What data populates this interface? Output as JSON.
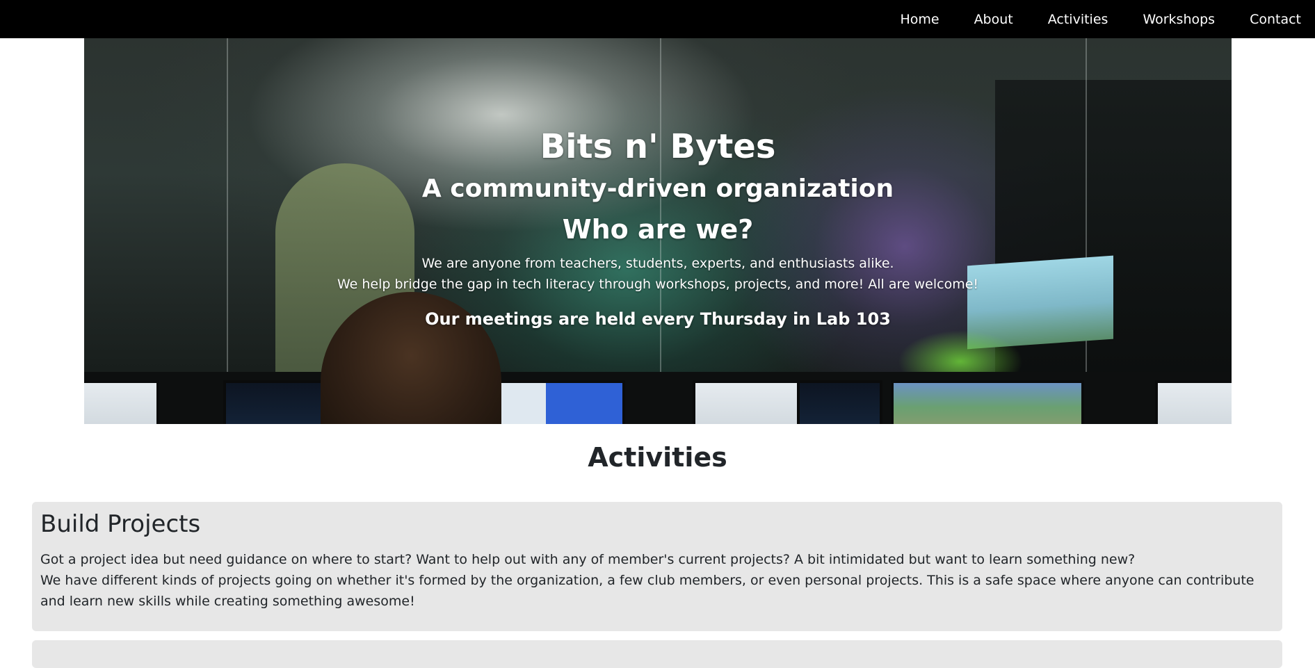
{
  "nav": {
    "items": [
      {
        "label": "Home"
      },
      {
        "label": "About"
      },
      {
        "label": "Activities"
      },
      {
        "label": "Workshops"
      },
      {
        "label": "Contact"
      }
    ]
  },
  "hero": {
    "title": "Bits n' Bytes",
    "subtitle": "A community-driven organization",
    "question": "Who are we?",
    "line1": "We are anyone from teachers, students, experts, and enthusiasts alike.",
    "line2": "We help bridge the gap in tech literacy through workshops, projects, and more! All are welcome!",
    "meeting": "Our meetings are held every Thursday in Lab 103"
  },
  "activities": {
    "title": "Activities",
    "cards": [
      {
        "title": "Build Projects",
        "line1": "Got a project idea but need guidance on where to start? Want to help out with any of member's current projects? A bit intimidated but want to learn something new?",
        "line2": "We have different kinds of projects going on whether it's formed by the organization, a few club members, or even personal projects. This is a safe space where anyone can contribute and learn new skills while creating something awesome!"
      }
    ]
  },
  "colors": {
    "navbar": "#000000",
    "card_background": "#e7e7e7",
    "text": "#212529",
    "hero_text": "#ffffff"
  }
}
